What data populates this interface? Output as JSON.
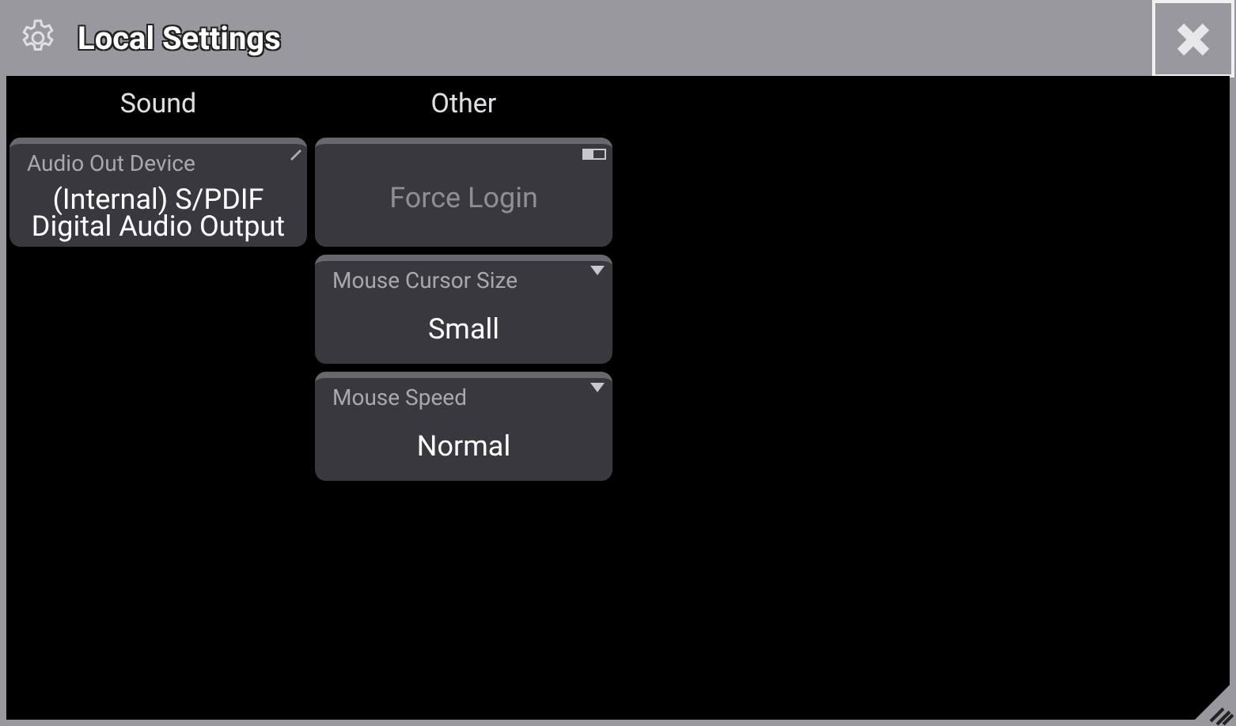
{
  "window": {
    "title": "Local Settings"
  },
  "columns": [
    {
      "heading": "Sound",
      "items": [
        {
          "kind": "edit",
          "label": "Audio Out Device",
          "value": "(Internal) S/PDIF Digital Audio Output"
        }
      ]
    },
    {
      "heading": "Other",
      "items": [
        {
          "kind": "toggle",
          "value": "Force Login",
          "on": false
        },
        {
          "kind": "select",
          "label": "Mouse Cursor Size",
          "value": "Small"
        },
        {
          "kind": "select",
          "label": "Mouse Speed",
          "value": "Normal"
        }
      ]
    }
  ]
}
